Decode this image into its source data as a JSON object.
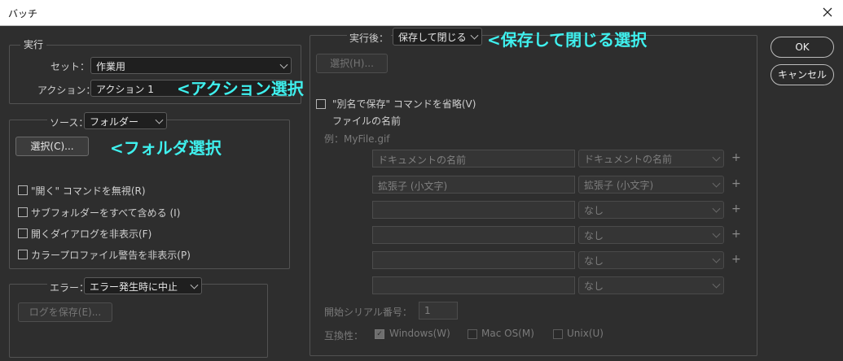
{
  "window": {
    "title": "バッチ",
    "close_label": "✕"
  },
  "buttons": {
    "ok": "OK",
    "cancel": "キャンセル"
  },
  "run": {
    "legend": "実行",
    "set_label": "セット：",
    "set_value": "作業用",
    "action_label": "アクション：",
    "action_value": "アクション 1"
  },
  "source": {
    "label": "ソース：",
    "value": "フォルダー",
    "choose_button": "選択(C)...",
    "checkboxes": [
      "\"開く\" コマンドを無視(R)",
      "サブフォルダーをすべて含める (I)",
      "開くダイアログを非表示(F)",
      "カラープロファイル警告を非表示(P)"
    ]
  },
  "error": {
    "label": "エラー：",
    "value": "エラー発生時に中止",
    "save_log_button": "ログを保存(E)..."
  },
  "destination": {
    "label": "実行後：",
    "value": "保存して閉じる",
    "choose_button": "選択(H)...",
    "override_save_as": "\"別名で保存\" コマンドを省略(V)",
    "file_naming_label": "ファイルの名前",
    "example": "例：MyFile.gif",
    "naming_rows": [
      {
        "text": "ドキュメントの名前",
        "select": "ドキュメントの名前",
        "plus": "+"
      },
      {
        "text": "拡張子 (小文字)",
        "select": "拡張子 (小文字)",
        "plus": "+"
      },
      {
        "text": "",
        "select": "なし",
        "plus": "+"
      },
      {
        "text": "",
        "select": "なし",
        "plus": "+"
      },
      {
        "text": "",
        "select": "なし",
        "plus": "+"
      },
      {
        "text": "",
        "select": "なし",
        "plus": ""
      }
    ],
    "serial_label": "開始シリアル番号：",
    "serial_value": "1",
    "compat_label": "互換性：",
    "compat": [
      {
        "label": "Windows(W)",
        "checked": true
      },
      {
        "label": "Mac OS(M)",
        "checked": false
      },
      {
        "label": "Unix(U)",
        "checked": false
      }
    ]
  },
  "annotations": {
    "action": "<アクション選択",
    "folder": "<フォルダ選択",
    "save_close": "<保存して閉じる選択"
  },
  "colors": {
    "annotation": "#3ff0ee",
    "background": "#2e2e2e"
  }
}
